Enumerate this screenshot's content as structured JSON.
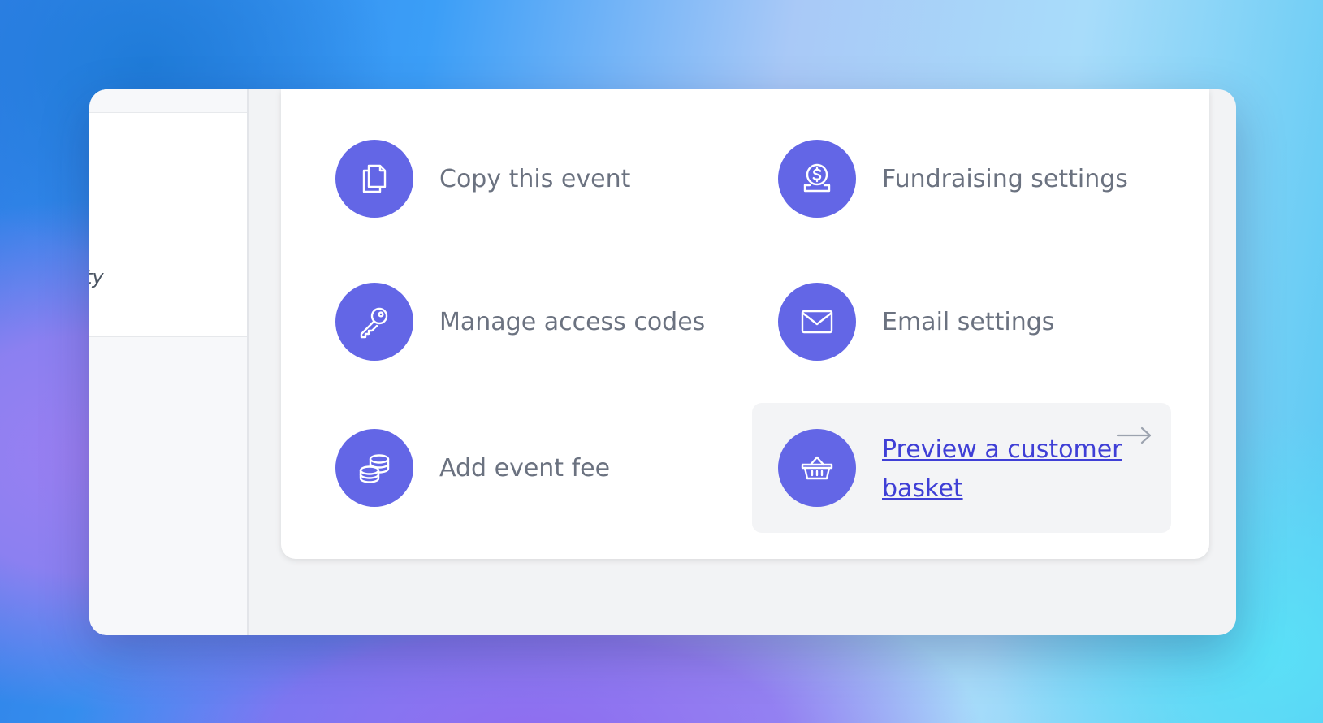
{
  "sidebar": {
    "partial_text": "ty"
  },
  "actions": [
    {
      "label": "Copy this event",
      "icon": "copy-icon"
    },
    {
      "label": "Fundraising settings",
      "icon": "dollar-coin-icon"
    },
    {
      "label": "Manage access codes",
      "icon": "key-icon"
    },
    {
      "label": "Email settings",
      "icon": "envelope-icon"
    },
    {
      "label": "Add event fee",
      "icon": "coins-stack-icon"
    }
  ],
  "preview": {
    "label": "Preview a customer basket",
    "icon": "basket-icon",
    "arrow_icon": "arrow-right-icon"
  },
  "colors": {
    "accent": "#6366e6",
    "link": "#3f3fd6",
    "label_text": "#6b7280",
    "highlight_bg": "#f3f4f6"
  }
}
